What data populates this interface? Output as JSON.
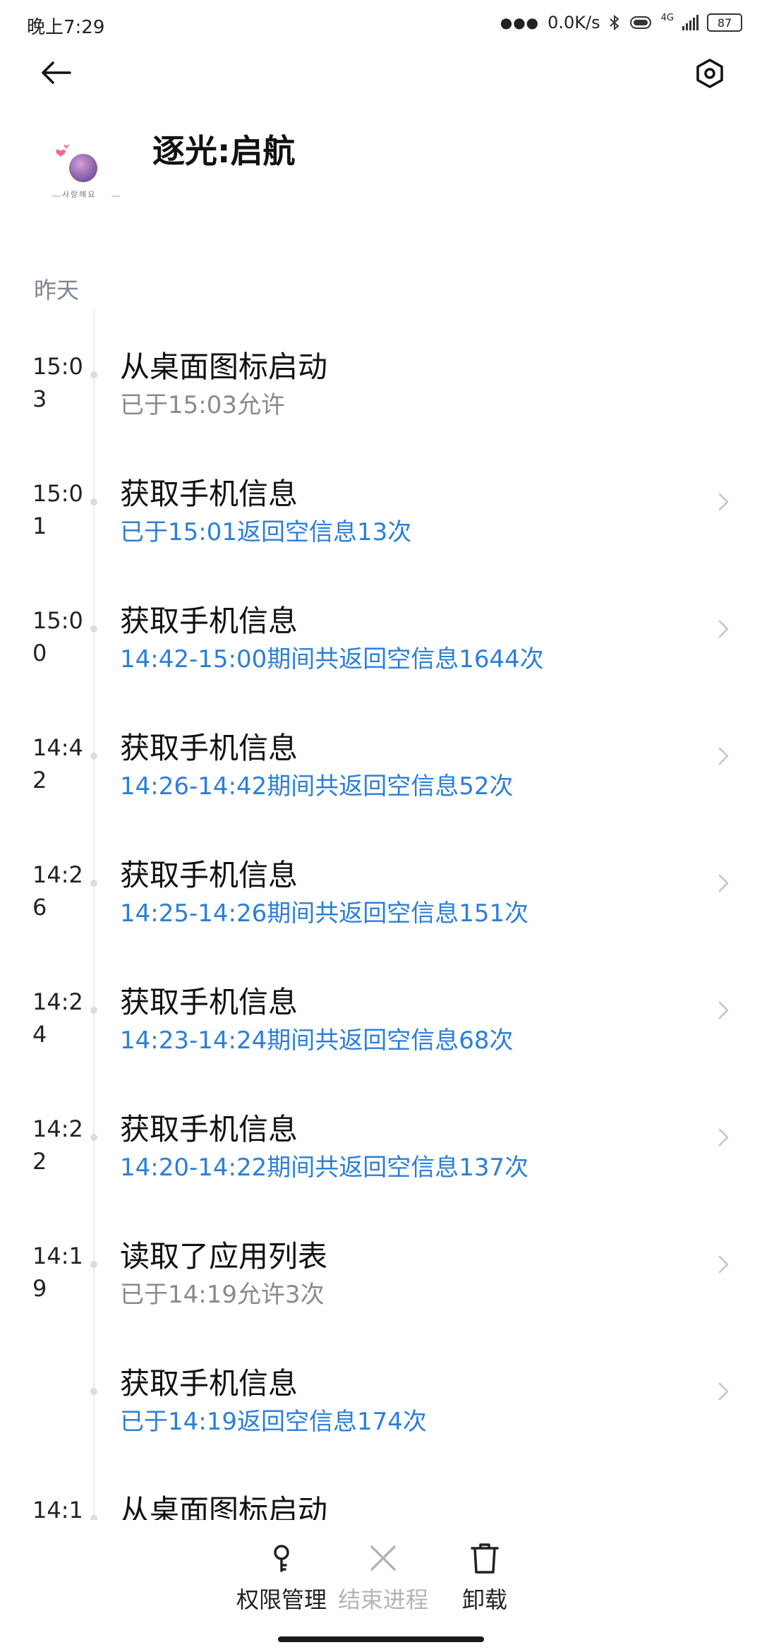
{
  "status_bar": {
    "time": "晚上7:29",
    "net_speed": "0.0K/s",
    "network_type": "4G",
    "battery": "87"
  },
  "header": {
    "app_name": "逐光:启航",
    "icon_caption": "사랑해요"
  },
  "section_label": "昨天",
  "events": [
    {
      "time": "15:03",
      "title": "从桌面图标启动",
      "detail": "已于15:03允许",
      "detail_style": "gray",
      "has_chevron": false
    },
    {
      "time": "15:01",
      "title": "获取手机信息",
      "detail": "已于15:01返回空信息13次",
      "detail_style": "blue",
      "has_chevron": true
    },
    {
      "time": "15:00",
      "title": "获取手机信息",
      "detail": "14:42-15:00期间共返回空信息1644次",
      "detail_style": "blue",
      "has_chevron": true
    },
    {
      "time": "14:42",
      "title": "获取手机信息",
      "detail": "14:26-14:42期间共返回空信息52次",
      "detail_style": "blue",
      "has_chevron": true
    },
    {
      "time": "14:26",
      "title": "获取手机信息",
      "detail": "14:25-14:26期间共返回空信息151次",
      "detail_style": "blue",
      "has_chevron": true
    },
    {
      "time": "14:24",
      "title": "获取手机信息",
      "detail": "14:23-14:24期间共返回空信息68次",
      "detail_style": "blue",
      "has_chevron": true
    },
    {
      "time": "14:22",
      "title": "获取手机信息",
      "detail": "14:20-14:22期间共返回空信息137次",
      "detail_style": "blue",
      "has_chevron": true
    },
    {
      "time": "14:19",
      "title": "读取了应用列表",
      "detail": "已于14:19允许3次",
      "detail_style": "gray",
      "has_chevron": true
    },
    {
      "time": "",
      "title": "获取手机信息",
      "detail": "已于14:19返回空信息174次",
      "detail_style": "blue",
      "has_chevron": true
    },
    {
      "time": "14:1",
      "title": "从桌面图标启动",
      "detail": "",
      "detail_style": "gray",
      "has_chevron": false
    }
  ],
  "actions": [
    {
      "label": "权限管理",
      "icon": "key-icon",
      "enabled": true
    },
    {
      "label": "结束进程",
      "icon": "close-icon",
      "enabled": false
    },
    {
      "label": "卸载",
      "icon": "trash-icon",
      "enabled": true
    }
  ],
  "colors": {
    "accent_blue": "#2b7fd9",
    "secondary_gray": "#8a8a8a",
    "section_gray": "#7d8590",
    "disabled_gray": "#b4b4b4"
  }
}
